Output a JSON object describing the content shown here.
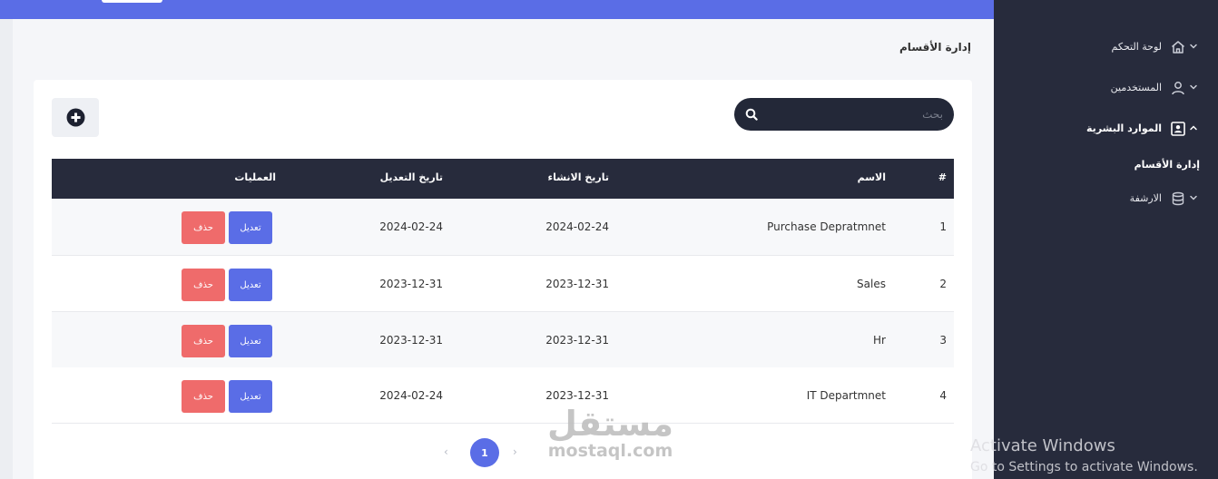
{
  "page": {
    "title": "إدارة الأقسام"
  },
  "search": {
    "placeholder": "بحث"
  },
  "table": {
    "headers": {
      "num": "#",
      "name": "الاسم",
      "created": "تاريخ الانشاء",
      "modified": "تاريخ التعديل",
      "ops": "العمليات"
    },
    "rows": [
      {
        "num": "1",
        "name": "Purchase Depratmnet",
        "created": "2024-02-24",
        "modified": "2024-02-24",
        "edit": "تعديل",
        "del": "حذف"
      },
      {
        "num": "2",
        "name": "Sales",
        "created": "2023-12-31",
        "modified": "2023-12-31",
        "edit": "تعديل",
        "del": "حذف"
      },
      {
        "num": "3",
        "name": "Hr",
        "created": "2023-12-31",
        "modified": "2023-12-31",
        "edit": "تعديل",
        "del": "حذف"
      },
      {
        "num": "4",
        "name": "IT Departmnet",
        "created": "2023-12-31",
        "modified": "2024-02-24",
        "edit": "تعديل",
        "del": "حذف"
      }
    ]
  },
  "pagination": {
    "prev": "‹",
    "current": "1",
    "next": "›"
  },
  "sidebar": {
    "items": [
      {
        "label": "لوحة التحكم",
        "icon": "home-icon"
      },
      {
        "label": "المستخدمين",
        "icon": "user-icon"
      },
      {
        "label": "الموارد البشرية",
        "icon": "id-card-icon"
      },
      {
        "label": "الارشفة",
        "icon": "database-icon"
      }
    ],
    "sub_items": [
      {
        "label": "إدارة الأقسام"
      }
    ]
  },
  "watermark": {
    "arabic": "مستقل",
    "latin": "mostaql.com"
  },
  "os_notice": {
    "line1": "Activate Windows",
    "line2": "Go to Settings to activate Windows."
  },
  "colors": {
    "primary": "#5a6de6",
    "dark": "#272b3c",
    "danger": "#ef6b6b"
  }
}
